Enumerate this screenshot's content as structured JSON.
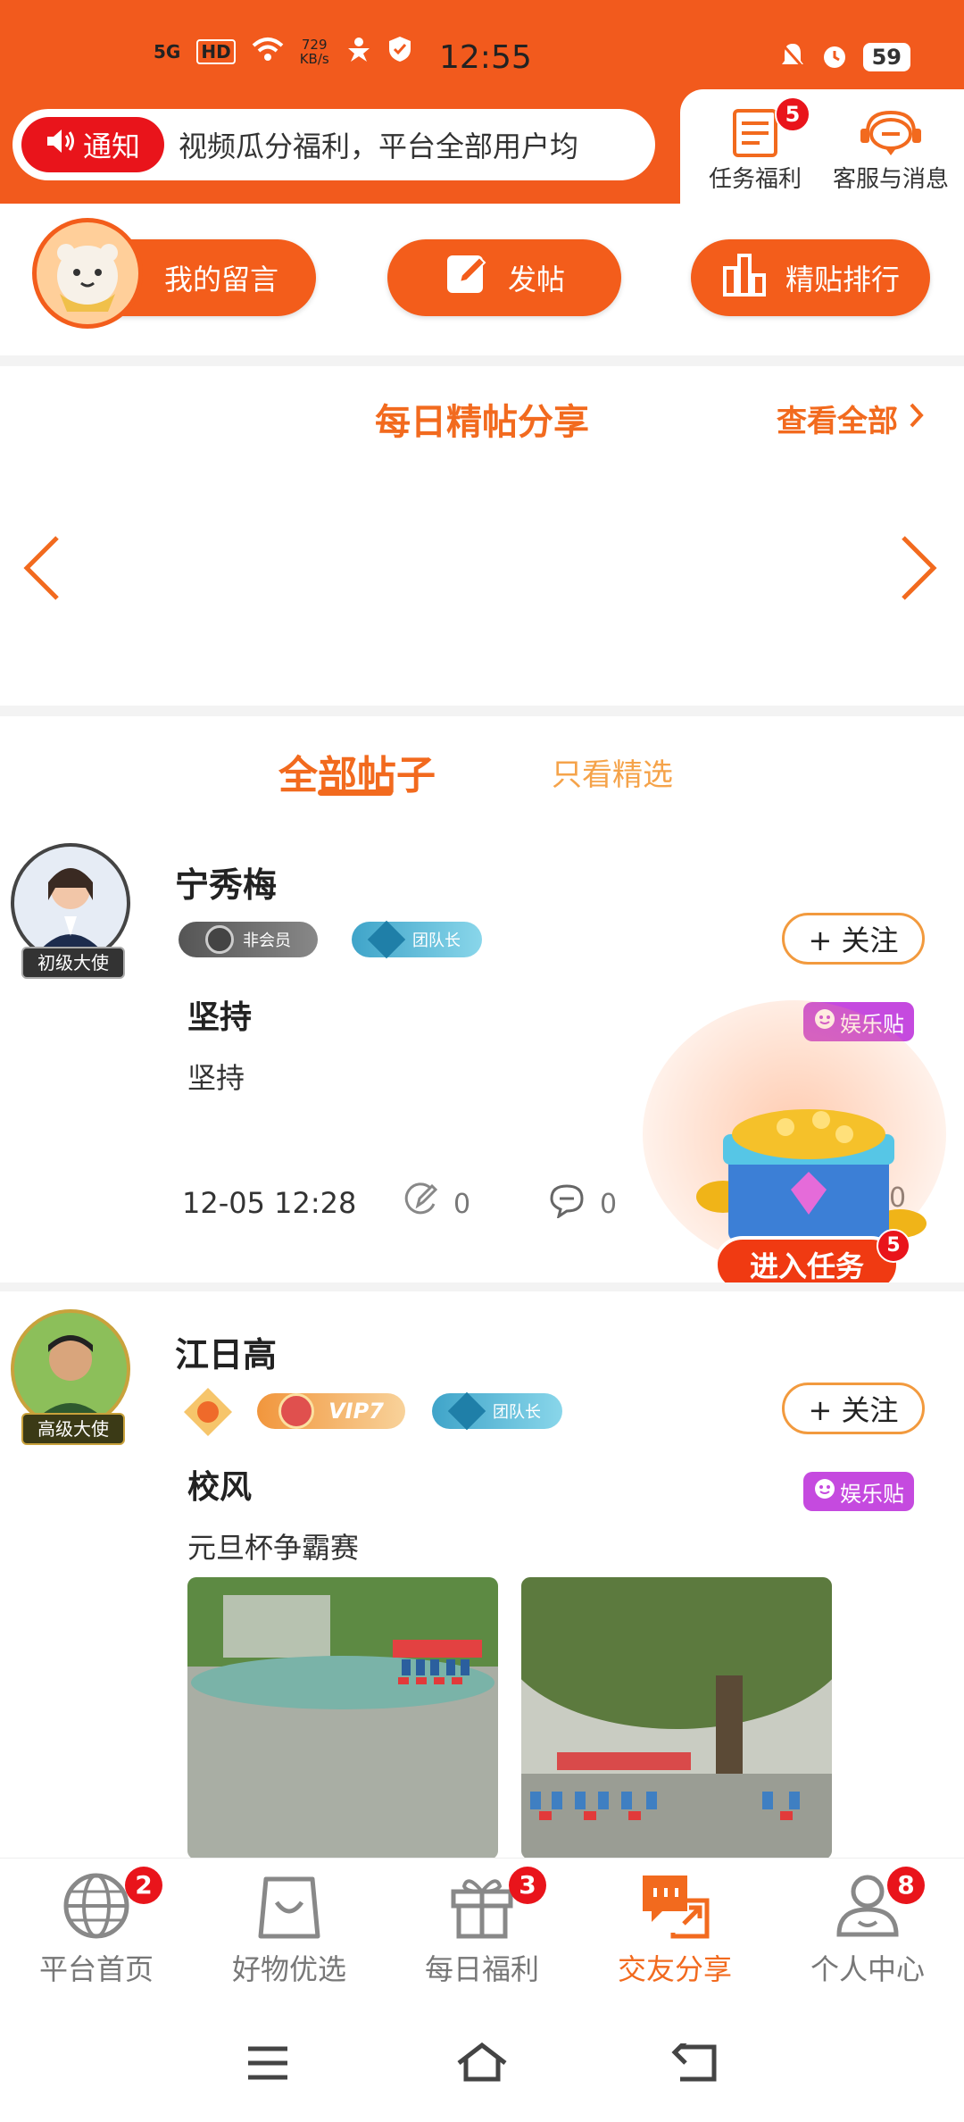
{
  "status_bar": {
    "network": "5G",
    "hd": "HD",
    "speed_value": "729",
    "speed_unit": "KB/s",
    "time": "12:55",
    "battery": "59"
  },
  "header": {
    "notice_label": "通知",
    "notice_text": "视频瓜分福利，平台全部用户均",
    "task_label": "任务福利",
    "task_badge": "5",
    "service_label": "客服与消息"
  },
  "actions": {
    "my_messages": "我的留言",
    "post": "发帖",
    "ranking": "精贴排行"
  },
  "featured": {
    "title": "每日精帖分享",
    "view_all": "查看全部"
  },
  "tabs": {
    "all_posts": "全部帖子",
    "featured_only": "只看精选"
  },
  "posts": [
    {
      "username": "宁秀梅",
      "rank_label": "初级大使",
      "member_tag": "非会员",
      "team_tag": "团队长",
      "follow_label": "+ 关注",
      "category": "娱乐贴",
      "title": "坚持",
      "body": "坚持",
      "time": "12-05 12:28",
      "likes": "0",
      "comments": "0",
      "views": "0"
    },
    {
      "username": "江日高",
      "rank_label": "高级大使",
      "vip_tag": "VIP7",
      "team_tag": "团队长",
      "follow_label": "+ 关注",
      "category": "娱乐贴",
      "title": "校风",
      "body": "元旦杯争霸赛"
    }
  ],
  "floating_task": {
    "label": "进入任务",
    "badge": "5"
  },
  "bottom_nav": [
    {
      "label": "平台首页",
      "badge": "2",
      "icon": "globe-icon"
    },
    {
      "label": "好物优选",
      "badge": "",
      "icon": "shopping-bag-icon"
    },
    {
      "label": "每日福利",
      "badge": "3",
      "icon": "gift-icon"
    },
    {
      "label": "交友分享",
      "badge": "",
      "icon": "chat-share-icon"
    },
    {
      "label": "个人中心",
      "badge": "8",
      "icon": "person-icon"
    }
  ],
  "colors": {
    "brand": "#f25a1d",
    "accent": "#f26a1e",
    "badge": "#e9141b",
    "entertainment_tag": "#c54adf"
  }
}
